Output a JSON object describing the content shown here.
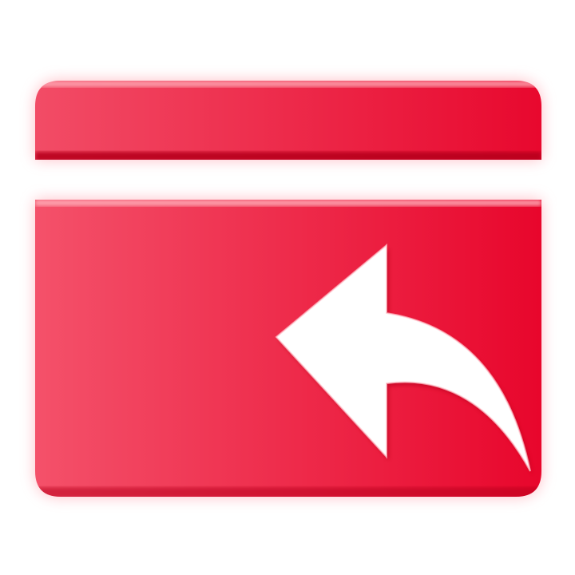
{
  "icon": {
    "name": "card-return-icon",
    "description_name": "payment-card-refund-icon"
  },
  "colors": {
    "background": "#ffffff",
    "card_left": "#f4516a",
    "card_right": "#e8062c",
    "card_edge_dark": "#b8041f",
    "card_highlight": "#ffb3bd",
    "glow": "#ff8a99",
    "arrow": "#ffffff"
  }
}
